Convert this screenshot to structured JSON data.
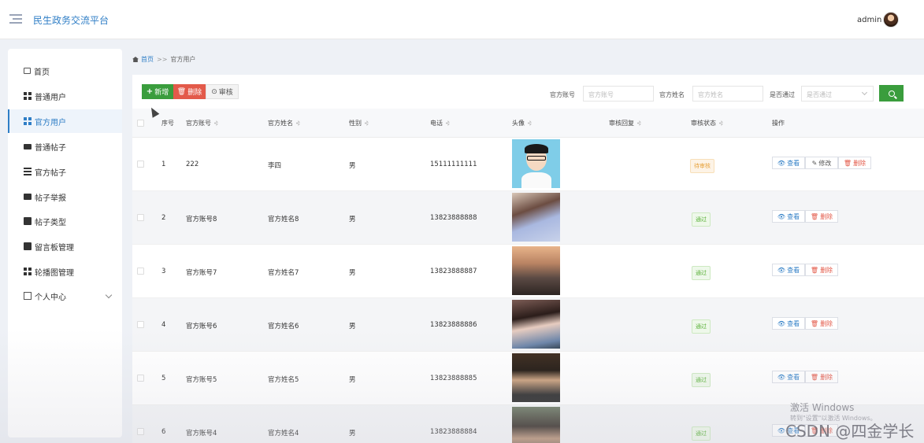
{
  "header": {
    "app_title": "民生政务交流平台",
    "user": "admin"
  },
  "sidebar": {
    "items": [
      {
        "label": "首页",
        "icon": "home-icon"
      },
      {
        "label": "普通用户",
        "icon": "grid-icon"
      },
      {
        "label": "官方用户",
        "icon": "grid-icon",
        "active": true
      },
      {
        "label": "普通帖子",
        "icon": "monitor-icon"
      },
      {
        "label": "官方帖子",
        "icon": "list-icon"
      },
      {
        "label": "帖子举报",
        "icon": "briefcase-icon"
      },
      {
        "label": "帖子类型",
        "icon": "clipboard-icon"
      },
      {
        "label": "留言板管理",
        "icon": "clipboard-icon"
      },
      {
        "label": "轮播图管理",
        "icon": "grid-icon"
      },
      {
        "label": "个人中心",
        "icon": "calendar-icon"
      }
    ]
  },
  "breadcrumb": {
    "home": "首页",
    "separator": ">>",
    "current": "官方用户"
  },
  "toolbar": {
    "add_label": "新增",
    "delete_label": "删除",
    "audit_label": "审核"
  },
  "filters": {
    "account_label": "官方账号",
    "account_placeholder": "官方账号",
    "name_label": "官方姓名",
    "name_placeholder": "官方姓名",
    "pass_label": "是否通过",
    "pass_placeholder": "是否通过"
  },
  "table": {
    "headers": {
      "index": "序号",
      "account": "官方账号",
      "name": "官方姓名",
      "gender": "性别",
      "phone": "电话",
      "avatar": "头像",
      "reply": "审核回复",
      "status": "审核状态",
      "ops": "操作"
    },
    "actions": {
      "view": "查看",
      "edit": "修改",
      "delete": "删除"
    },
    "rows": [
      {
        "index": "1",
        "account": "222",
        "name": "李四",
        "gender": "男",
        "phone": "15111111111",
        "status": "待审核"
      },
      {
        "index": "2",
        "account": "官方账号8",
        "name": "官方姓名8",
        "gender": "男",
        "phone": "13823888888",
        "status": "通过"
      },
      {
        "index": "3",
        "account": "官方账号7",
        "name": "官方姓名7",
        "gender": "男",
        "phone": "13823888887",
        "status": "通过"
      },
      {
        "index": "4",
        "account": "官方账号6",
        "name": "官方姓名6",
        "gender": "男",
        "phone": "13823888886",
        "status": "通过"
      },
      {
        "index": "5",
        "account": "官方账号5",
        "name": "官方姓名5",
        "gender": "男",
        "phone": "13823888885",
        "status": "通过"
      },
      {
        "index": "6",
        "account": "官方账号4",
        "name": "官方姓名4",
        "gender": "男",
        "phone": "13823888884",
        "status": "通过"
      }
    ]
  },
  "overlay": {
    "activate_windows": "激活 Windows",
    "activate_windows_sub": "转到\"设置\"以激活 Windows。",
    "csdn": "CSDN @四金学长"
  },
  "colors": {
    "primary": "#2f7ec6",
    "success": "#3a9d3d",
    "danger": "#e35a4a",
    "warning": "#e6a23c"
  }
}
